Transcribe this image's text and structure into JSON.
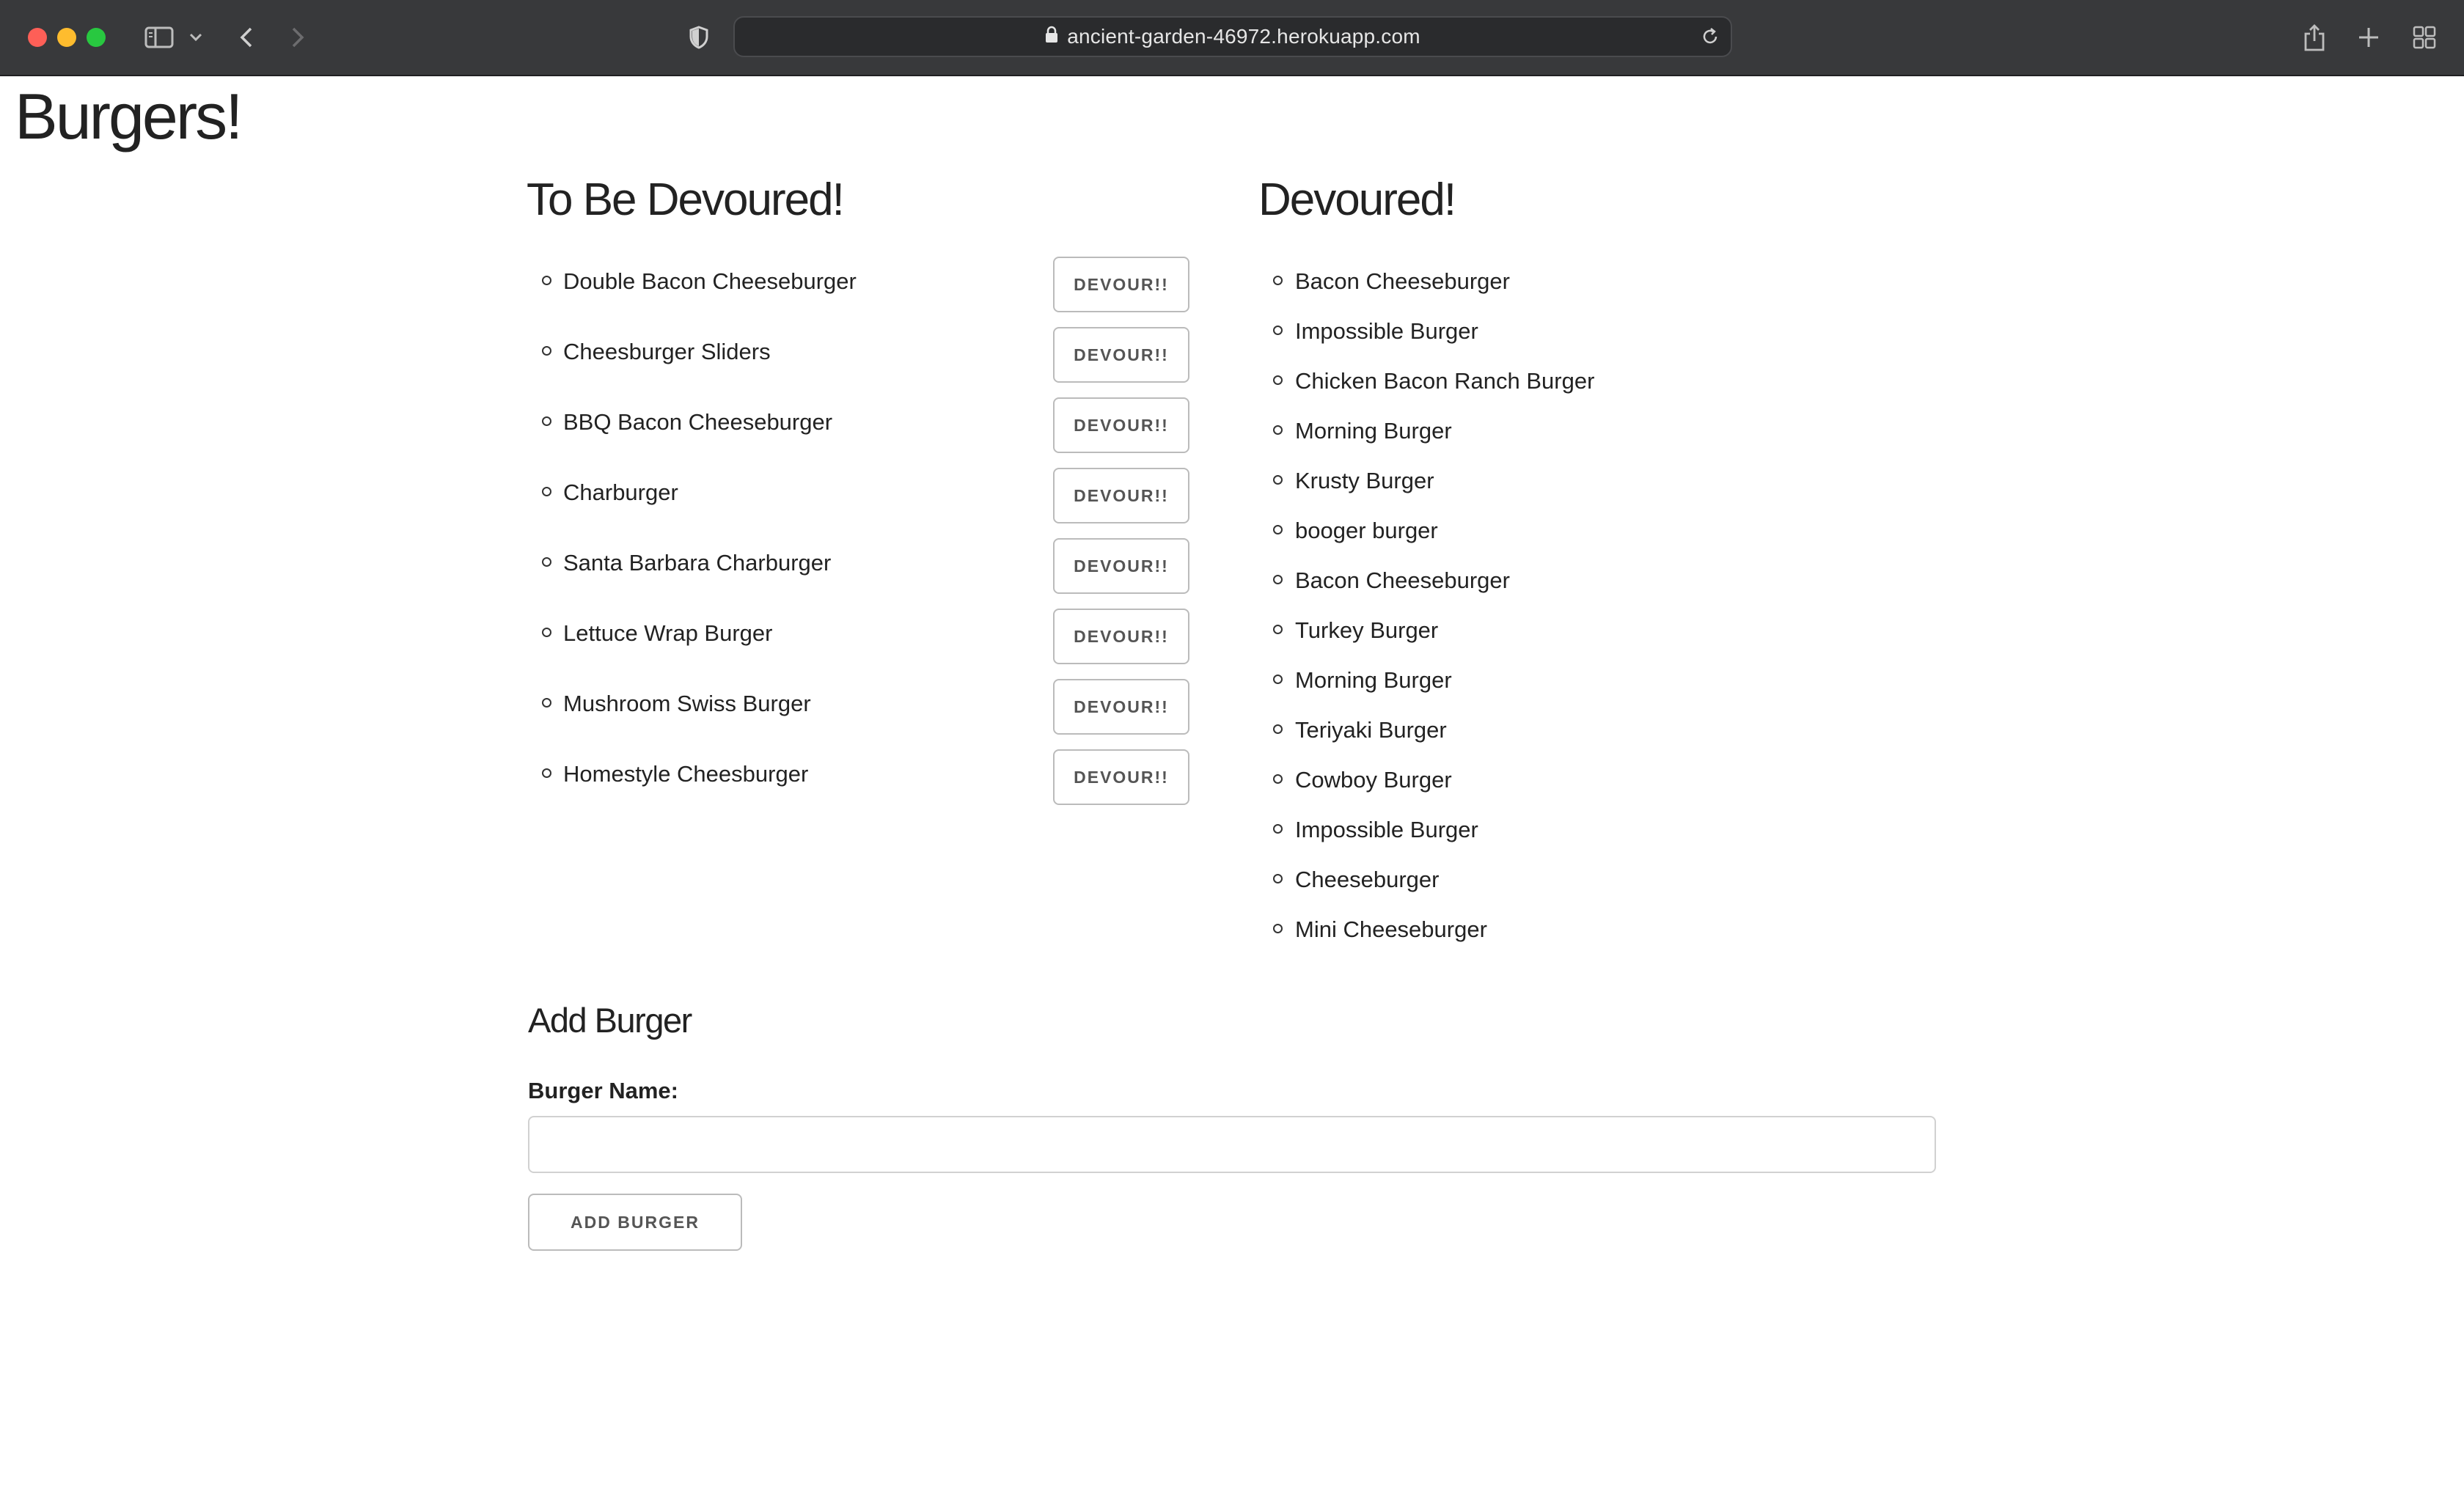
{
  "browser": {
    "url": "ancient-garden-46972.herokuapp.com"
  },
  "page": {
    "title": "Burgers!"
  },
  "to_be_devoured": {
    "heading": "To Be Devoured!",
    "button_label": "DEVOUR!!",
    "items": [
      "Double Bacon Cheeseburger",
      "Cheesburger Sliders",
      "BBQ Bacon Cheeseburger",
      "Charburger",
      "Santa Barbara Charburger",
      "Lettuce Wrap Burger",
      "Mushroom Swiss Burger",
      "Homestyle Cheesburger"
    ]
  },
  "devoured": {
    "heading": "Devoured!",
    "items": [
      "Bacon Cheeseburger",
      "Impossible Burger",
      "Chicken Bacon Ranch Burger",
      "Morning Burger",
      "Krusty Burger",
      "booger burger",
      "Bacon Cheeseburger",
      "Turkey Burger",
      "Morning Burger",
      "Teriyaki Burger",
      "Cowboy Burger",
      "Impossible Burger",
      "Cheeseburger",
      "Mini Cheeseburger"
    ]
  },
  "add_form": {
    "heading": "Add Burger",
    "label": "Burger Name:",
    "value": "",
    "button_label": "ADD BURGER"
  },
  "icons": {
    "sidebar": "sidebar-icon",
    "back": "chevron-left-icon",
    "forward": "chevron-right-icon",
    "privacy": "shield-icon",
    "lock": "lock-icon",
    "reload": "reload-icon",
    "share": "share-icon",
    "new_tab": "plus-icon",
    "tabs": "tab-overview-icon"
  }
}
